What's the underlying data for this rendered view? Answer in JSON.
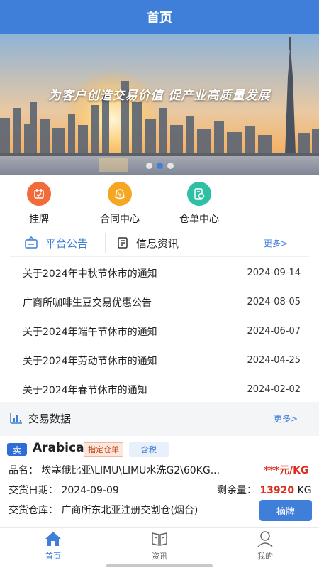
{
  "header": {
    "title": "首页"
  },
  "banner": {
    "slogan": "为客户创造交易价值  促产业高质量发展",
    "slide_count": 3,
    "active_slide": 2
  },
  "quick_actions": [
    {
      "label": "挂牌",
      "icon": "listing-icon",
      "color": "#f26b3a"
    },
    {
      "label": "合同中心",
      "icon": "contract-icon",
      "color": "#f5a623"
    },
    {
      "label": "仓单中心",
      "icon": "warehouse-receipt-icon",
      "color": "#2ebfa5"
    }
  ],
  "notice_tabs": {
    "active": "平台公告",
    "inactive": "信息资讯",
    "more": "更多>"
  },
  "notices": [
    {
      "title": "关于2024年中秋节休市的通知",
      "date": "2024-09-14"
    },
    {
      "title": "广商所咖啡生豆交易优惠公告",
      "date": "2024-08-05"
    },
    {
      "title": "关于2024年端午节休市的通知",
      "date": "2024-06-07"
    },
    {
      "title": "关于2024年劳动节休市的通知",
      "date": "2024-04-25"
    },
    {
      "title": "关于2024年春节休市的通知",
      "date": "2024-02-02"
    }
  ],
  "trade_section": {
    "title": "交易数据",
    "more": "更多>"
  },
  "trade_card": {
    "side": "卖",
    "name": "Arabica",
    "tag_warehouse": "指定仓单",
    "tag_tax": "含税",
    "product_label": "品名：",
    "product_value": "埃塞俄比亚\\LIMU\\LIMU水洗G2\\60KG...",
    "price": "***元/KG",
    "delivery_date_label": "交货日期：",
    "delivery_date": "2024-09-09",
    "remaining_label": "剩余量：",
    "remaining_value": "13920",
    "remaining_unit": "KG",
    "warehouse_label": "交货仓库：",
    "warehouse_value": "广商所东北亚注册交割仓(烟台)",
    "action": "摘牌"
  },
  "tabbar": [
    {
      "label": "首页",
      "icon": "home-icon",
      "active": true
    },
    {
      "label": "资讯",
      "icon": "news-icon",
      "active": false
    },
    {
      "label": "我的",
      "icon": "profile-icon",
      "active": false
    }
  ],
  "colors": {
    "primary": "#3f7fd9",
    "price_red": "#d9301f"
  }
}
